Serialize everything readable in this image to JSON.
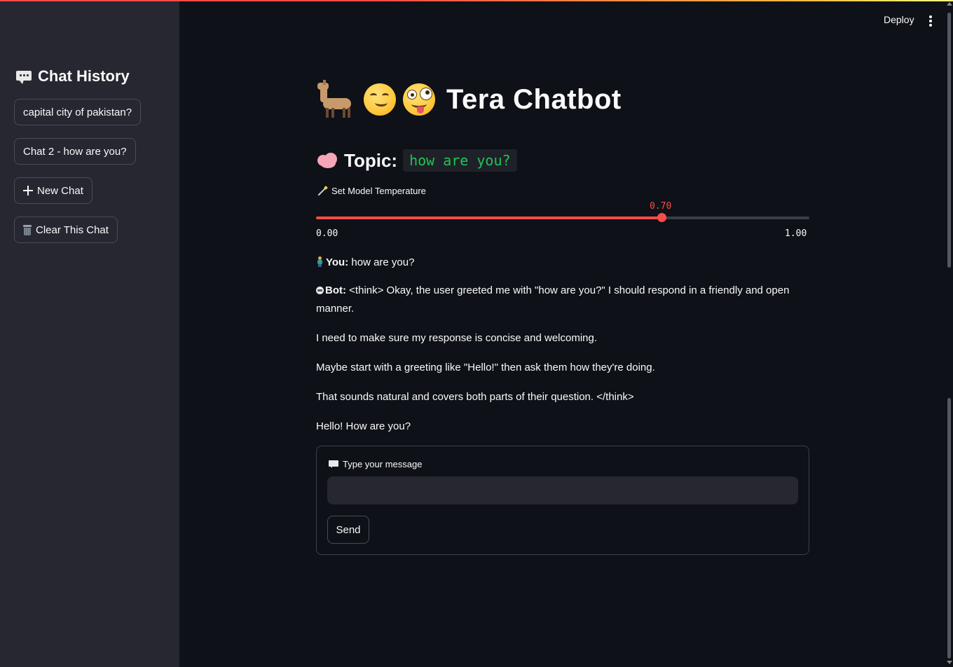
{
  "header": {
    "deploy_label": "Deploy"
  },
  "sidebar": {
    "title": "Chat History",
    "chats": [
      "capital city of pakistan?",
      "Chat 2 - how are you?"
    ],
    "new_chat_label": "New Chat",
    "clear_chat_label": "Clear This Chat"
  },
  "main": {
    "title": "Tera Chatbot",
    "topic_label": "Topic:",
    "topic_value": "how are you?",
    "slider": {
      "label": "Set Model Temperature",
      "value": "0.70",
      "min": "0.00",
      "max": "1.00",
      "fraction": 0.7
    },
    "messages": {
      "user_label": "You:",
      "user_text": "how are you?",
      "bot_label": "Bot:",
      "bot_p1": "<think> Okay, the user greeted me with \"how are you?\" I should respond in a friendly and open manner.",
      "bot_p2": "I need to make sure my response is concise and welcoming.",
      "bot_p3": "Maybe start with a greeting like \"Hello!\" then ask them how they're doing.",
      "bot_p4": "That sounds natural and covers both parts of their question. </think>",
      "bot_p5": "Hello! How are you?"
    },
    "form": {
      "input_label": "Type your message",
      "input_value": "",
      "send_label": "Send"
    }
  },
  "colors": {
    "accent": "#ff4b4b",
    "code_green": "#21c354",
    "background": "#0e1117",
    "sidebar_bg": "#262730"
  }
}
